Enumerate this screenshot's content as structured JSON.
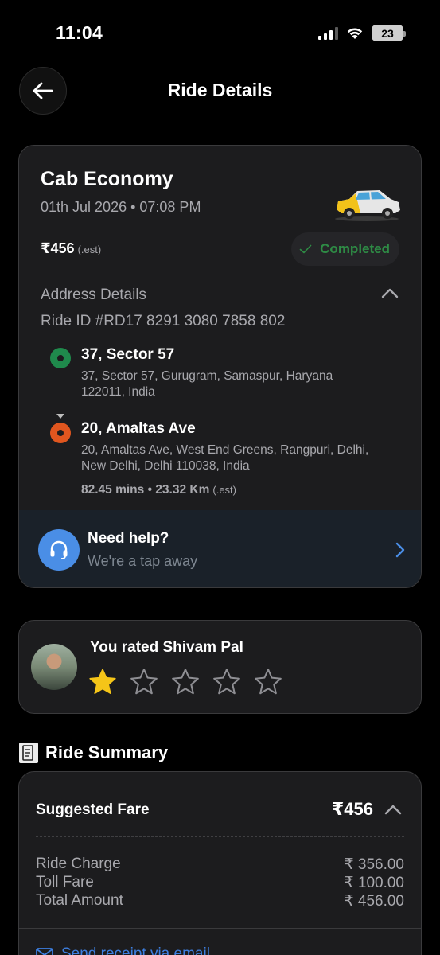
{
  "status_bar": {
    "time": "11:04",
    "battery": "23"
  },
  "header": {
    "title": "Ride Details"
  },
  "ride": {
    "service": "Cab Economy",
    "datetime": "01th Jul 2026 • 07:08 PM",
    "price": "₹456",
    "price_note": "(.est)",
    "status": "Completed",
    "address_section_title": "Address Details",
    "ride_id": "Ride ID #RD17 8291 3080 7858 802",
    "pickup": {
      "name": "37, Sector 57",
      "address": "37, Sector 57, Gurugram, Samaspur, Haryana 122011, India"
    },
    "drop": {
      "name": "20, Amaltas Ave",
      "address": "20, Amaltas Ave, West End Greens, Rangpuri, Delhi, New Delhi, Delhi 110038, India"
    },
    "trip_meta": "82.45 mins • 23.32 Km",
    "trip_meta_note": "(.est)"
  },
  "help": {
    "title": "Need help?",
    "subtitle": "We're a tap away"
  },
  "rating": {
    "title": "You rated Shivam Pal",
    "stars_given": 1,
    "stars_total": 5
  },
  "summary": {
    "title": "Ride Summary",
    "fare_title": "Suggested Fare",
    "fare_total": "₹456",
    "rows": [
      {
        "label": "Ride Charge",
        "value": "₹ 356.00"
      },
      {
        "label": "Toll Fare",
        "value": "₹ 100.00"
      },
      {
        "label": "Total Amount",
        "value": "₹ 456.00"
      }
    ],
    "receipt_link": "Send receipt via email"
  },
  "colors": {
    "status_green": "#2e8b45",
    "pickup_dot": "#1f8a4c",
    "drop_dot": "#e0561f",
    "help_blue": "#4a8ee6",
    "star_gold": "#f5c518",
    "link_blue": "#3d7fe0"
  },
  "icons": {
    "back": "arrow-left-icon",
    "check": "check-icon",
    "chevron_up": "chevron-up-icon",
    "chevron_right": "chevron-right-icon",
    "headset": "headset-icon",
    "receipt": "receipt-icon",
    "mail": "mail-icon"
  }
}
